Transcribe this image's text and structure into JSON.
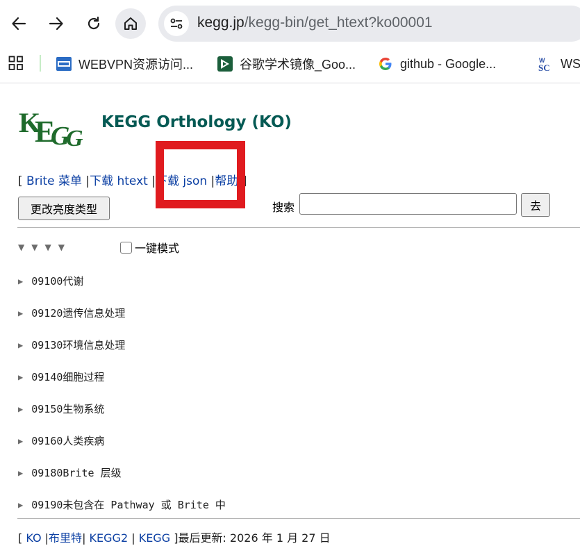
{
  "browser": {
    "url_host": "kegg.jp",
    "url_path": "/kegg-bin/get_htext?ko00001",
    "bookmarks": [
      {
        "label": "WEBVPN资源访问...",
        "icon": "webvpn-icon"
      },
      {
        "label": "谷歌学术镜像_Goo...",
        "icon": "scholar-mirror-icon"
      },
      {
        "label": "github - Google...",
        "icon": "google-g-icon"
      },
      {
        "label": "WS",
        "icon": "wsc-icon"
      }
    ]
  },
  "page": {
    "title": "KEGG Orthology (KO)",
    "menu": {
      "open": "[",
      "brite_menu": "Brite 菜单",
      "sep1": "|",
      "download_htext": "下载 htext",
      "sep2": "|",
      "download_json": "下载 json",
      "sep3": "|",
      "help": "帮助",
      "close": "]"
    },
    "brightness_button": "更改亮度类型",
    "search_label": "搜索",
    "search_value": "",
    "go_button": "去",
    "oneclick_label": "一键模式",
    "tree": [
      {
        "code": "09100",
        "label": "代谢"
      },
      {
        "code": "09120",
        "label": "遗传信息处理"
      },
      {
        "code": "09130",
        "label": "环境信息处理"
      },
      {
        "code": "09140",
        "label": "细胞过程"
      },
      {
        "code": "09150",
        "label": "生物系统"
      },
      {
        "code": "09160",
        "label": "人类疾病"
      },
      {
        "code": "09180",
        "label": "Brite 层级"
      },
      {
        "code": "09190",
        "label": "未包含在 Pathway 或 Brite 中"
      }
    ],
    "footer": {
      "open": "[",
      "ko": "KO",
      "sep1": "|",
      "brite": "布里特",
      "sep2": "|",
      "kegg2": "KEGG2",
      "sep3": "|",
      "kegg": "KEGG",
      "close": "]",
      "last_updated": "最后更新: 2026 年 1 月 27 日"
    }
  },
  "colors": {
    "title": "#055a54",
    "link": "#0b3fa3",
    "highlight": "#e01b1f"
  }
}
